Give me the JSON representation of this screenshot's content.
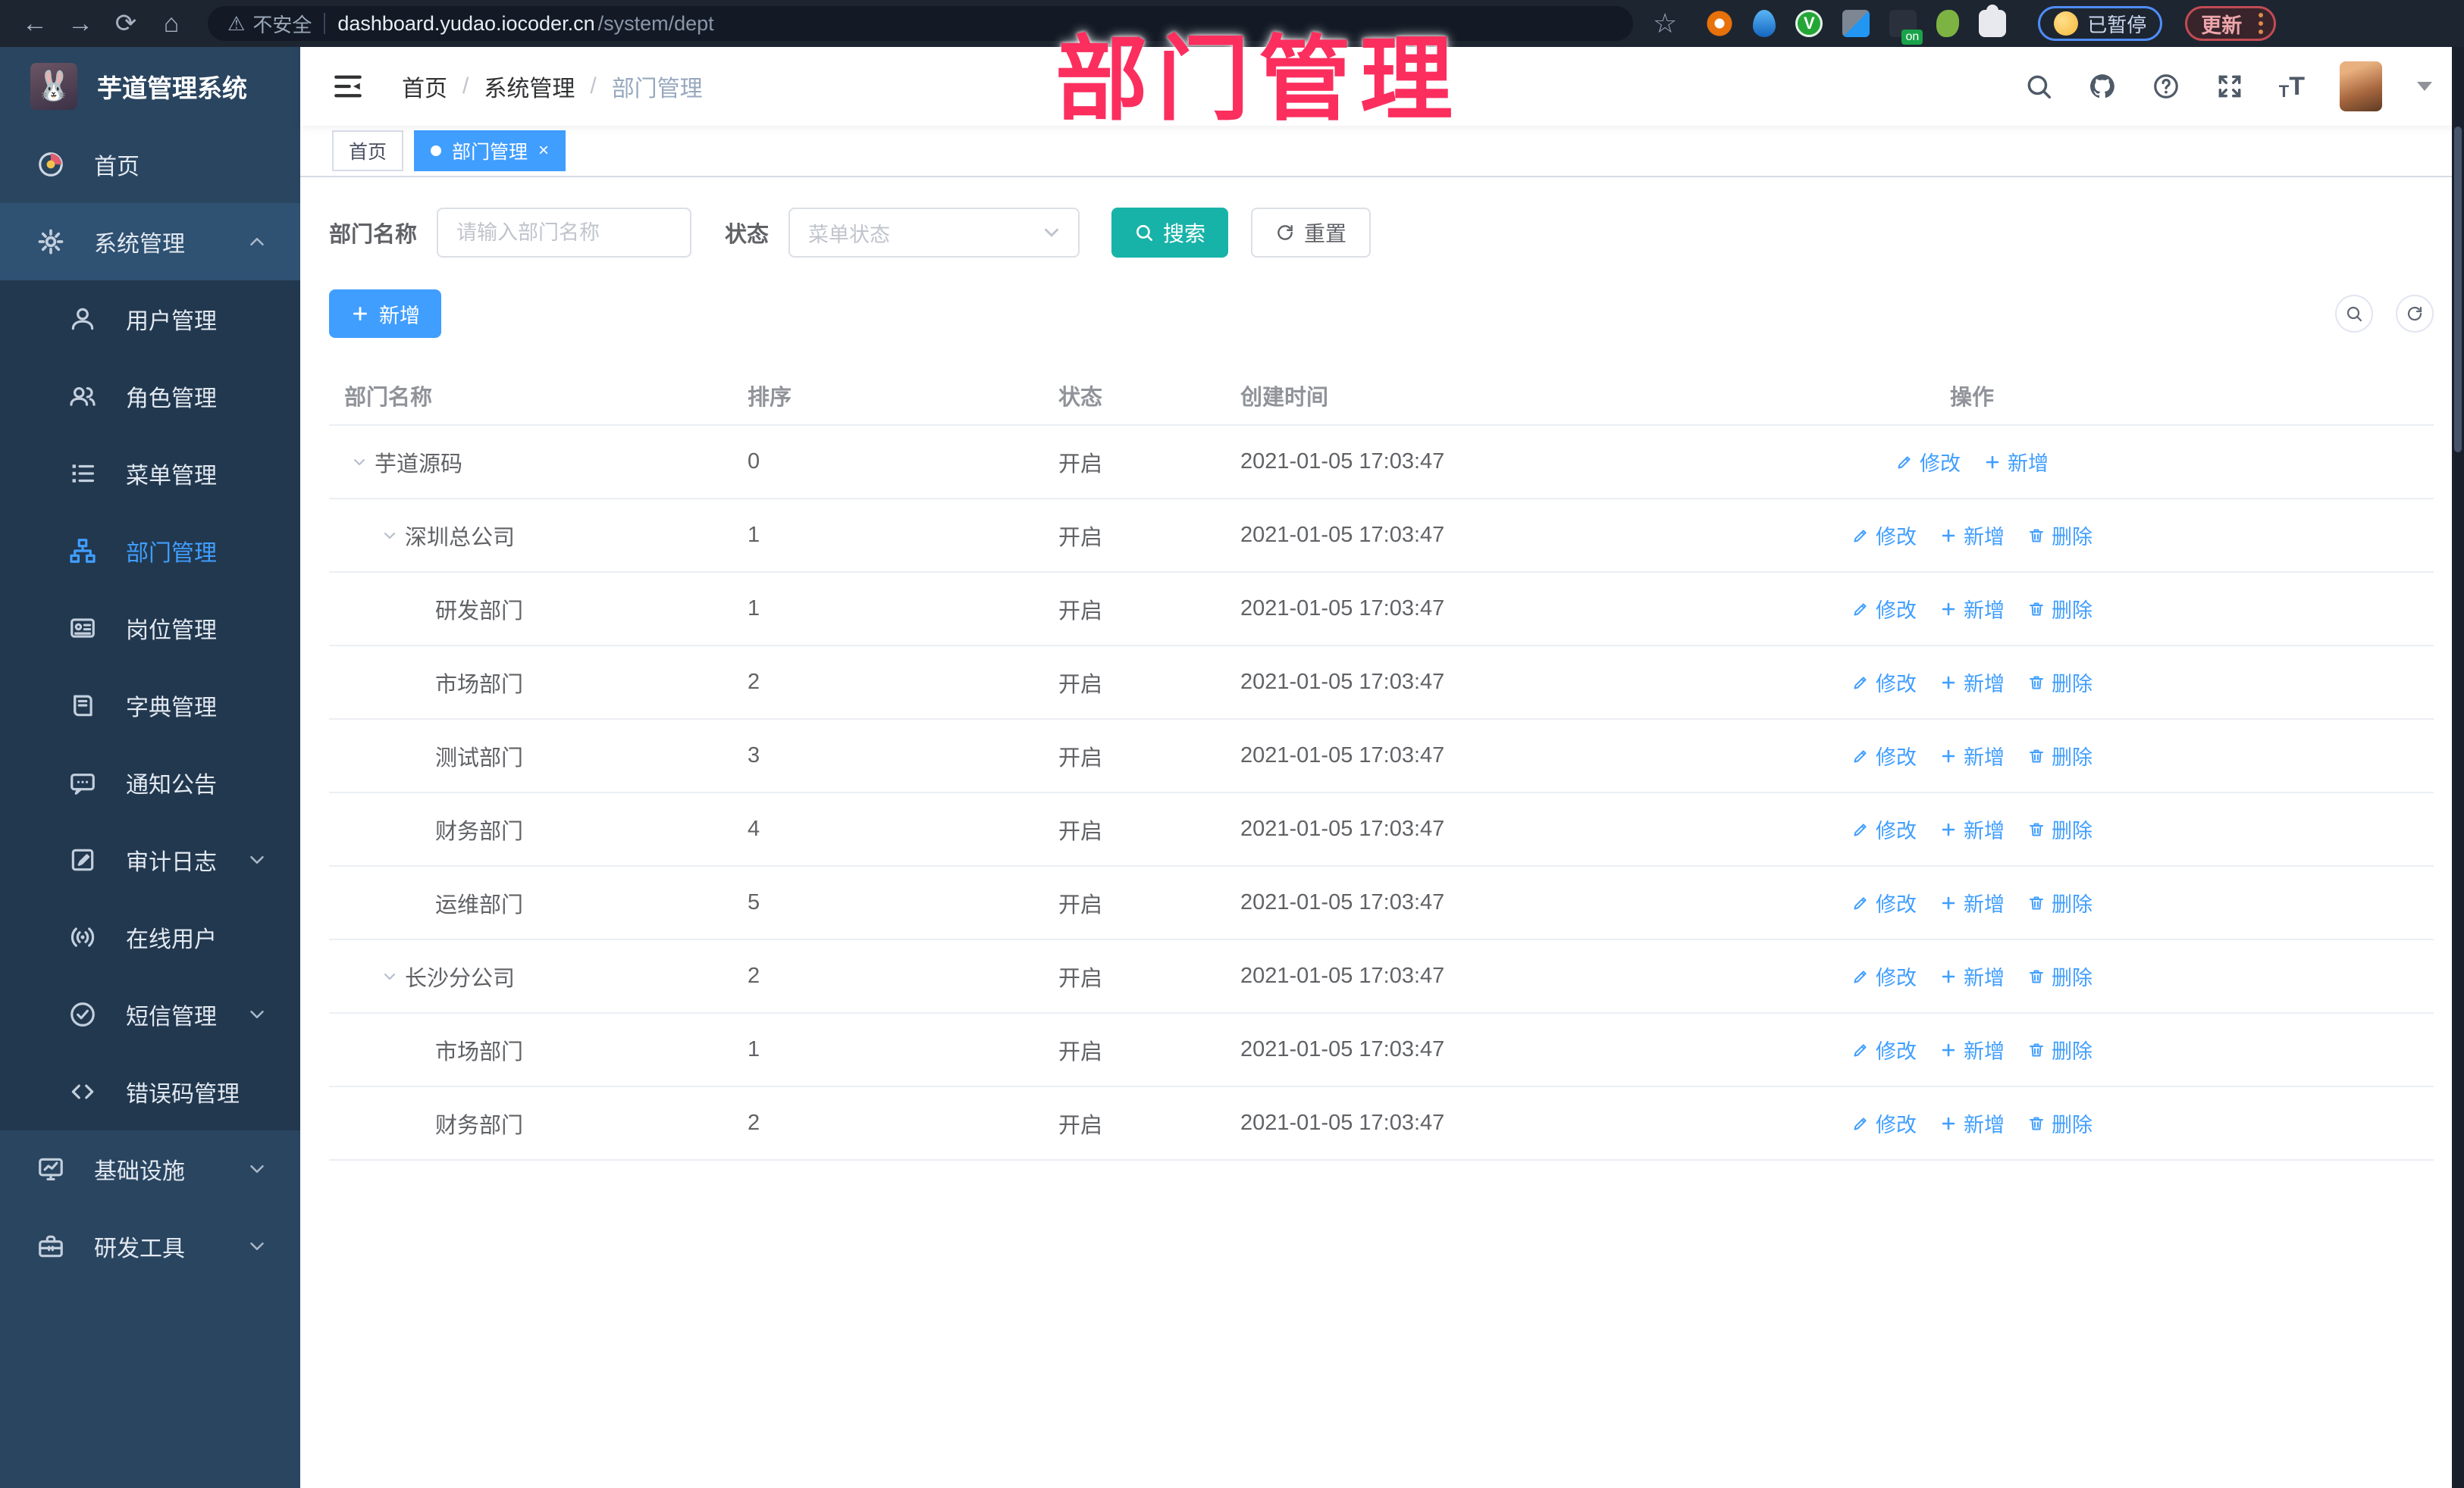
{
  "colors": {
    "accent": "#409eff",
    "teal": "#18b3a8",
    "annotation": "#fb2e5e",
    "sidebar_bg": "#2a4560",
    "submenu_bg": "#22384f"
  },
  "annotation": {
    "text": "部门管理"
  },
  "browser": {
    "security_label": "不安全",
    "url_host": "dashboard.yudao.iocoder.cn",
    "url_path": "/system/dept",
    "profile_badge": "已暂停",
    "update_label": "更新",
    "extensions": [
      "ext-gear",
      "ext-drop",
      "ext-greenv",
      "ext-grid",
      "ext-on",
      "ext-fig",
      "ext-puzzle"
    ],
    "green_v": "V"
  },
  "app": {
    "title": "芋道管理系统",
    "breadcrumb": [
      "首页",
      "系统管理",
      "部门管理"
    ],
    "breadcrumb_separator": "/",
    "tabs": [
      {
        "label": "首页",
        "active": false,
        "closable": false
      },
      {
        "label": "部门管理",
        "active": true,
        "closable": true
      }
    ]
  },
  "sidebar": {
    "items": [
      {
        "label": "首页",
        "icon": "dashboard-icon",
        "children": []
      },
      {
        "label": "系统管理",
        "icon": "gear-icon",
        "expanded": true,
        "caret": "up",
        "children": [
          {
            "label": "用户管理",
            "icon": "user-icon"
          },
          {
            "label": "角色管理",
            "icon": "users-icon"
          },
          {
            "label": "菜单管理",
            "icon": "menu-list-icon"
          },
          {
            "label": "部门管理",
            "icon": "org-tree-icon",
            "active": true
          },
          {
            "label": "岗位管理",
            "icon": "id-card-icon"
          },
          {
            "label": "字典管理",
            "icon": "book-icon"
          },
          {
            "label": "通知公告",
            "icon": "announcement-icon"
          },
          {
            "label": "审计日志",
            "icon": "log-icon",
            "caret": "down"
          },
          {
            "label": "在线用户",
            "icon": "online-user-icon"
          },
          {
            "label": "短信管理",
            "icon": "sms-icon",
            "caret": "down"
          },
          {
            "label": "错误码管理",
            "icon": "code-icon"
          }
        ]
      },
      {
        "label": "基础设施",
        "icon": "monitor-icon",
        "caret": "down",
        "children": []
      },
      {
        "label": "研发工具",
        "icon": "toolbox-icon",
        "caret": "down",
        "children": []
      }
    ]
  },
  "filters": {
    "name_label": "部门名称",
    "name_placeholder": "请输入部门名称",
    "status_label": "状态",
    "status_placeholder": "菜单状态",
    "search_label": "搜索",
    "reset_label": "重置"
  },
  "toolbar": {
    "add_label": "新增"
  },
  "table": {
    "headers": [
      "部门名称",
      "排序",
      "状态",
      "创建时间",
      "操作"
    ],
    "action_labels": {
      "edit": "修改",
      "add": "新增",
      "delete": "删除"
    },
    "rows": [
      {
        "name": "芋道源码",
        "level": 0,
        "expandable": true,
        "sort": "0",
        "status": "开启",
        "time": "2021-01-05 17:03:47",
        "actions": [
          "edit",
          "add"
        ]
      },
      {
        "name": "深圳总公司",
        "level": 1,
        "expandable": true,
        "sort": "1",
        "status": "开启",
        "time": "2021-01-05 17:03:47",
        "actions": [
          "edit",
          "add",
          "delete"
        ]
      },
      {
        "name": "研发部门",
        "level": 2,
        "expandable": false,
        "sort": "1",
        "status": "开启",
        "time": "2021-01-05 17:03:47",
        "actions": [
          "edit",
          "add",
          "delete"
        ]
      },
      {
        "name": "市场部门",
        "level": 2,
        "expandable": false,
        "sort": "2",
        "status": "开启",
        "time": "2021-01-05 17:03:47",
        "actions": [
          "edit",
          "add",
          "delete"
        ]
      },
      {
        "name": "测试部门",
        "level": 2,
        "expandable": false,
        "sort": "3",
        "status": "开启",
        "time": "2021-01-05 17:03:47",
        "actions": [
          "edit",
          "add",
          "delete"
        ]
      },
      {
        "name": "财务部门",
        "level": 2,
        "expandable": false,
        "sort": "4",
        "status": "开启",
        "time": "2021-01-05 17:03:47",
        "actions": [
          "edit",
          "add",
          "delete"
        ]
      },
      {
        "name": "运维部门",
        "level": 2,
        "expandable": false,
        "sort": "5",
        "status": "开启",
        "time": "2021-01-05 17:03:47",
        "actions": [
          "edit",
          "add",
          "delete"
        ]
      },
      {
        "name": "长沙分公司",
        "level": 1,
        "expandable": true,
        "sort": "2",
        "status": "开启",
        "time": "2021-01-05 17:03:47",
        "actions": [
          "edit",
          "add",
          "delete"
        ]
      },
      {
        "name": "市场部门",
        "level": 2,
        "expandable": false,
        "sort": "1",
        "status": "开启",
        "time": "2021-01-05 17:03:47",
        "actions": [
          "edit",
          "add",
          "delete"
        ]
      },
      {
        "name": "财务部门",
        "level": 2,
        "expandable": false,
        "sort": "2",
        "status": "开启",
        "time": "2021-01-05 17:03:47",
        "actions": [
          "edit",
          "add",
          "delete"
        ]
      }
    ]
  }
}
